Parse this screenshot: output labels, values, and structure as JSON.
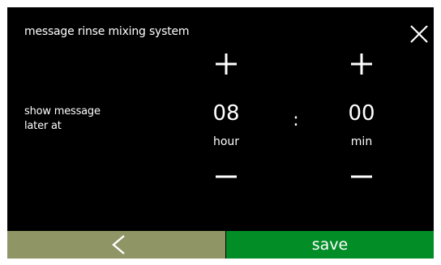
{
  "dialog": {
    "title": "message rinse mixing system",
    "label_line1": "show message",
    "label_line2": "later at",
    "separator": ":"
  },
  "time": {
    "hour": {
      "value": "08",
      "unit": "hour"
    },
    "minute": {
      "value": "00",
      "unit": "min"
    }
  },
  "footer": {
    "save_label": "save"
  },
  "icons": {
    "close": "close-icon",
    "increment": "plus-icon",
    "decrement": "minus-icon",
    "back": "chevron-left-icon"
  },
  "colors": {
    "panel_background": "#000000",
    "back_button": "#909566",
    "save_button": "#028d27",
    "text": "#ffffff"
  }
}
